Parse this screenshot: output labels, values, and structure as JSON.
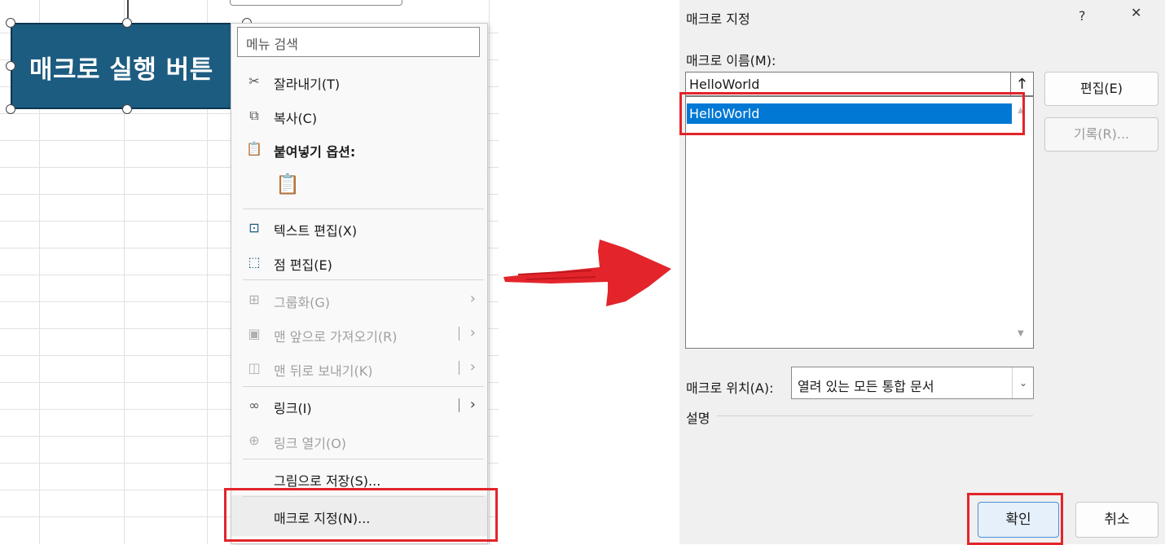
{
  "sheet": {
    "shape_label": "매크로 실행 버튼"
  },
  "context_menu": {
    "search_placeholder": "메뉴 검색",
    "items": [
      {
        "label": "잘라내기(T)",
        "icon": "scissors-icon",
        "enabled": true
      },
      {
        "label": "복사(C)",
        "icon": "copy-icon",
        "enabled": true
      },
      {
        "label": "붙여넣기 옵션:",
        "icon": "paste-icon",
        "enabled": true
      },
      {
        "label": "텍스트 편집(X)",
        "icon": "text-edit-icon",
        "enabled": true
      },
      {
        "label": "점 편집(E)",
        "icon": "edit-points-icon",
        "enabled": true
      },
      {
        "label": "그룹화(G)",
        "icon": "group-icon",
        "enabled": false
      },
      {
        "label": "맨 앞으로 가져오기(R)",
        "icon": "bring-to-front-icon",
        "enabled": false
      },
      {
        "label": "맨 뒤로 보내기(K)",
        "icon": "send-to-back-icon",
        "enabled": false
      },
      {
        "label": "링크(I)",
        "icon": "link-icon",
        "enabled": true
      },
      {
        "label": "링크 열기(O)",
        "icon": "open-link-icon",
        "enabled": false
      },
      {
        "label": "그림으로 저장(S)...",
        "icon": "",
        "enabled": true
      },
      {
        "label": "매크로 지정(N)...",
        "icon": "",
        "enabled": true
      }
    ]
  },
  "dialog": {
    "title": "매크로 지정",
    "help": "?",
    "close": "✕",
    "macro_name_label": "매크로 이름(M):",
    "macro_name_value": "HelloWorld",
    "macro_list": [
      "HelloWorld"
    ],
    "edit_button": "편집(E)",
    "record_button": "기록(R)...",
    "location_label": "매크로 위치(A):",
    "location_value": "열려 있는 모든 통합 문서",
    "description_label": "설명",
    "ok_button": "확인",
    "cancel_button": "취소"
  },
  "colors": {
    "highlight": "#e3242b",
    "shape_fill": "#1c5c80",
    "selection": "#0078d4"
  }
}
